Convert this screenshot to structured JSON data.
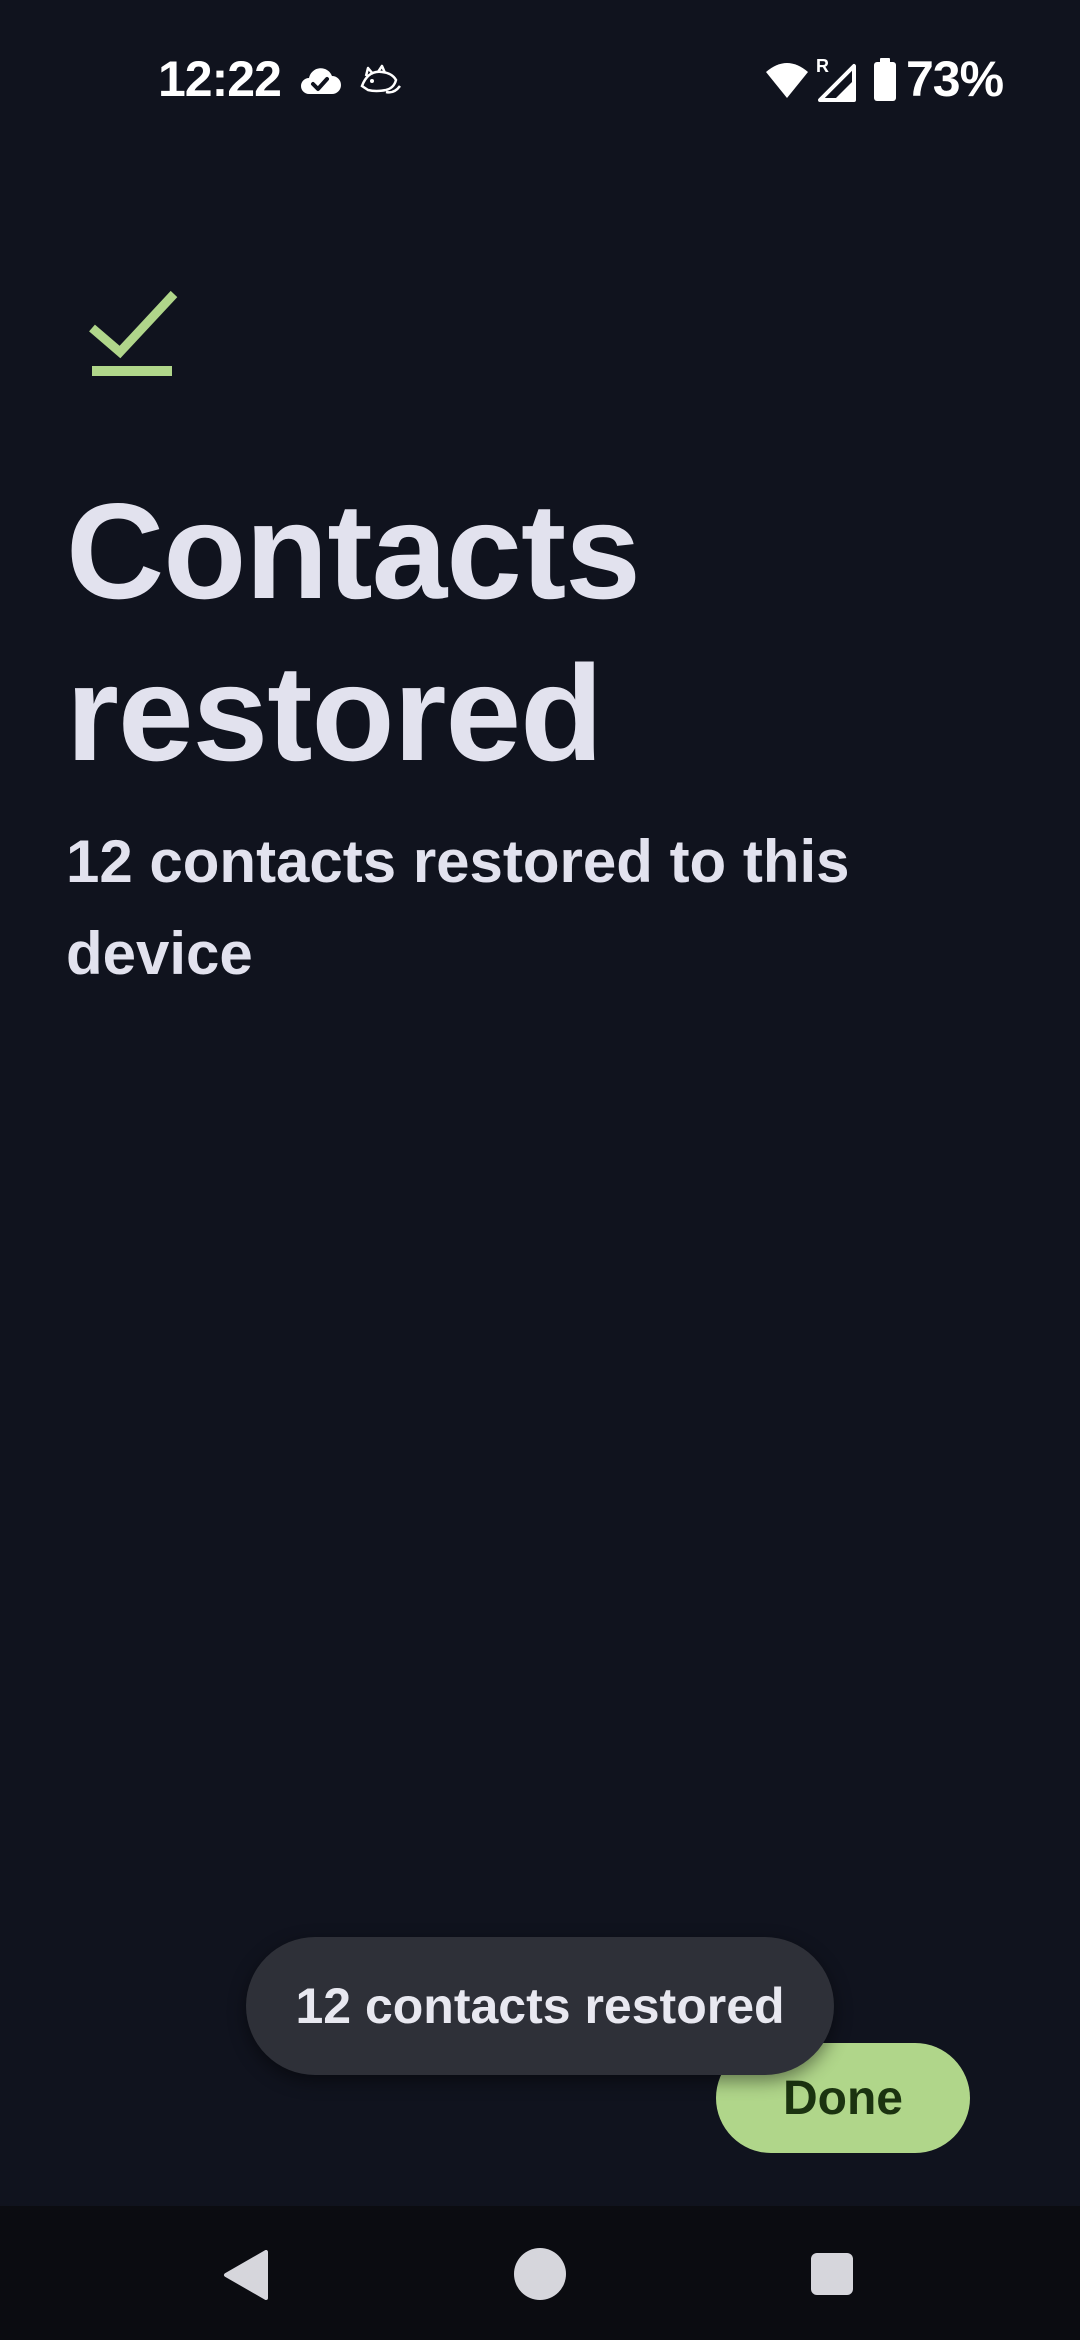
{
  "status_bar": {
    "time": "12:22",
    "battery_percent": "73%",
    "icons": [
      "cloud-check-icon",
      "cat-notification-icon",
      "wifi-icon",
      "signal-roaming-icon",
      "battery-icon"
    ]
  },
  "main": {
    "title": "Contacts restored",
    "subtitle": "12 contacts restored to this device",
    "accent_color": "#b0d68a"
  },
  "toast": {
    "text": "12 contacts restored"
  },
  "actions": {
    "done_label": "Done"
  },
  "nav_bar": {
    "buttons": [
      "back-icon",
      "home-icon",
      "recents-icon"
    ]
  }
}
